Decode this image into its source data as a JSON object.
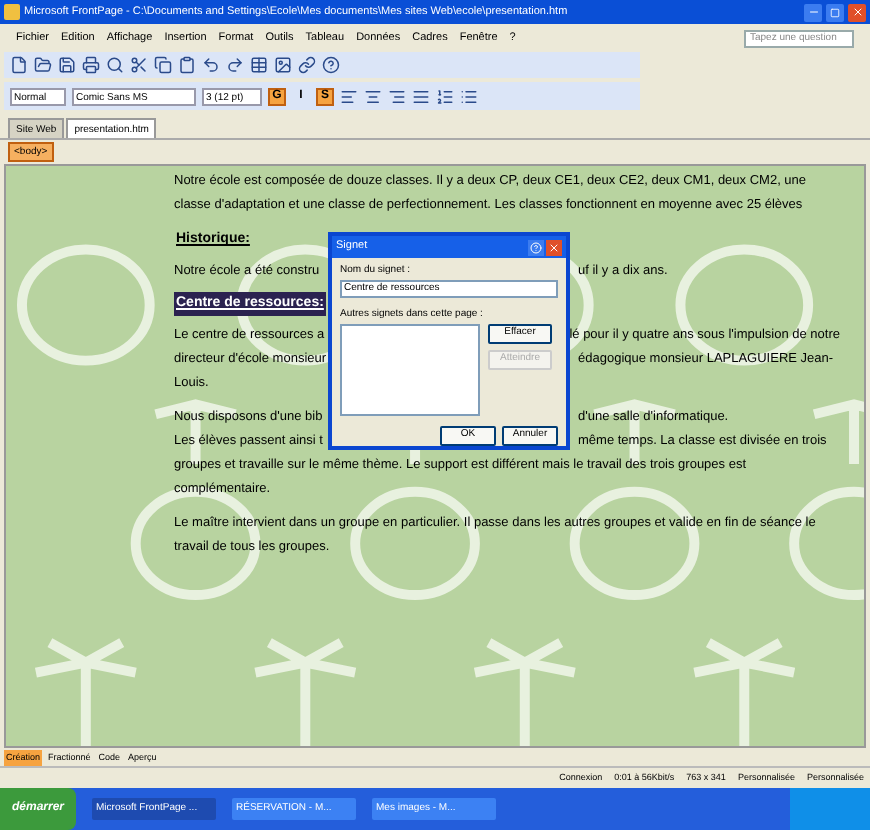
{
  "window": {
    "title": "Microsoft FrontPage - C:\\Documents and Settings\\Ecole\\Mes documents\\Mes sites Web\\ecole\\presentation.htm"
  },
  "menu": [
    "Fichier",
    "Edition",
    "Affichage",
    "Insertion",
    "Format",
    "Outils",
    "Tableau",
    "Données",
    "Cadres",
    "Fenêtre",
    "?"
  ],
  "help_box": {
    "placeholder": "Tapez une question"
  },
  "format_bar": {
    "style": "Normal",
    "font": "Comic Sans MS",
    "size": "3 (12 pt)",
    "buttons": [
      {
        "label": "G",
        "selected": true
      },
      {
        "label": "I",
        "selected": false
      },
      {
        "label": "S",
        "selected": true
      }
    ]
  },
  "doc_tabs": [
    {
      "label": "Site Web",
      "selected": false
    },
    {
      "label": "presentation.htm",
      "selected": true
    }
  ],
  "breadcrumb": "<body>",
  "content": [
    {
      "kind": "paragraph",
      "text": "Notre école est composée de douze classes. Il y a deux CP, deux CE1, deux CE2, deux CM1, deux CM2, une classe d'adaptation et une classe de perfectionnement. Les classes fonctionnent en moyenne avec 25 élèves"
    },
    {
      "kind": "heading",
      "text": "Historique:",
      "selected": false
    },
    {
      "kind": "split",
      "left": "Notre école a été constru",
      "right": "uf il y a dix ans."
    },
    {
      "kind": "heading",
      "text": "Centre de ressources:",
      "selected": true
    },
    {
      "kind": "split",
      "left": "Le centre de ressources a",
      "right": "lé pour il y quatre ans sous l'impulsion de notre"
    },
    {
      "kind": "split",
      "left": "directeur d'école monsieur",
      "right": "édagogique monsieur LAPLAGUIERE Jean-"
    },
    {
      "kind": "line",
      "text": "Louis."
    },
    {
      "kind": "split",
      "left": "Nous disposons d'une bib",
      "right": "d'une salle d'informatique."
    },
    {
      "kind": "split",
      "left": "Les élèves passent ainsi t",
      "right": "même temps. La classe est divisée en trois"
    },
    {
      "kind": "paragraph",
      "text": "groupes et travaille sur le même thème. Le support est différent mais le travail des trois groupes est complémentaire."
    },
    {
      "kind": "paragraph",
      "text": "Le maître intervient dans un groupe en particulier. Il passe dans les autres groupes et valide en fin de séance le travail de tous les groupes."
    }
  ],
  "dialog": {
    "title": "Signet",
    "name_label": "Nom du signet :",
    "name_value": "Centre de ressources",
    "list_label": "Autres signets dans cette page :",
    "side_buttons": [
      {
        "label": "Effacer",
        "disabled": false
      },
      {
        "label": "Atteindre",
        "disabled": true
      }
    ],
    "buttons": [
      "OK",
      "Annuler"
    ]
  },
  "view_tabs": [
    {
      "label": "Création",
      "selected": true
    },
    {
      "label": "Fractionné",
      "selected": false
    },
    {
      "label": "Code",
      "selected": false
    },
    {
      "label": "Aperçu",
      "selected": false
    }
  ],
  "status_bar": [
    "Connexion",
    "0:01 à 56Kbit/s",
    "763 x 341",
    "Personnalisée",
    "Personnalisée"
  ],
  "taskbar": {
    "start": "démarrer",
    "tasks": [
      {
        "label": "Microsoft FrontPage ...",
        "selected": true
      },
      {
        "label": "RÉSERVATION - M...",
        "selected": false
      },
      {
        "label": "Mes images - M...",
        "selected": false
      }
    ]
  }
}
